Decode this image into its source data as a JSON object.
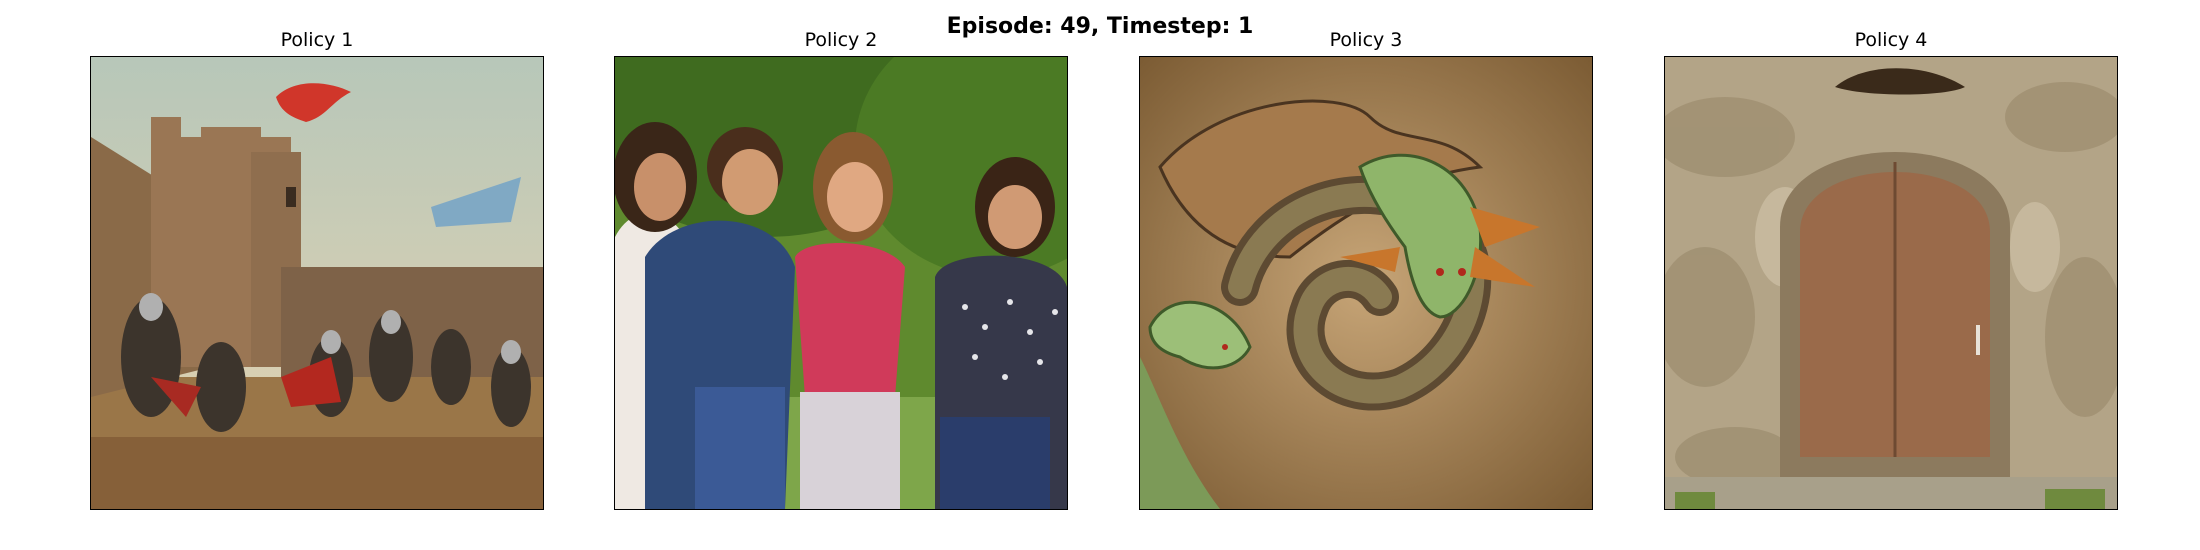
{
  "figure": {
    "title": "Episode: 49, Timestep: 1"
  },
  "panels": [
    {
      "title": "Policy 1"
    },
    {
      "title": "Policy 2"
    },
    {
      "title": "Policy 3"
    },
    {
      "title": "Policy 4"
    }
  ],
  "colors": {
    "background": "#ffffff",
    "frame_border": "#000000",
    "text": "#000000"
  }
}
